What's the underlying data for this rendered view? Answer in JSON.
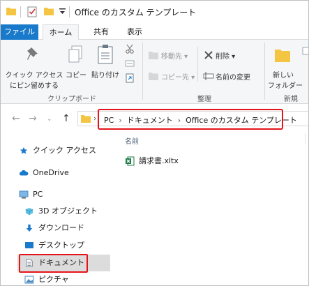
{
  "window": {
    "title": "Office のカスタム テンプレート"
  },
  "ribbon_tabs": [
    {
      "label": "ファイル"
    },
    {
      "label": "ホーム"
    },
    {
      "label": "共有"
    },
    {
      "label": "表示"
    }
  ],
  "clipboard": {
    "pin_line1": "クイック アクセス",
    "pin_line2": "にピン留めする",
    "copy": "コピー",
    "paste": "貼り付け",
    "group_name": "クリップボード"
  },
  "organize": {
    "move_to": "移動先",
    "copy_to": "コピー先",
    "delete": "削除",
    "rename": "名前の変更",
    "group_name": "整理"
  },
  "new_group": {
    "new_folder_line1": "新しい",
    "new_folder_line2": "フォルダー",
    "group_name": "新規"
  },
  "breadcrumb": [
    "PC",
    "ドキュメント",
    "Office のカスタム テンプレート"
  ],
  "nav_pane": {
    "items": [
      {
        "label": "クイック アクセス",
        "icon": "star-icon"
      },
      {
        "label": "OneDrive",
        "icon": "cloud-icon"
      },
      {
        "label": "PC",
        "icon": "computer-icon"
      },
      {
        "label": "3D オブジェクト",
        "icon": "cube-icon"
      },
      {
        "label": "ダウンロード",
        "icon": "download-icon"
      },
      {
        "label": "デスクトップ",
        "icon": "desktop-icon"
      },
      {
        "label": "ドキュメント",
        "icon": "document-icon",
        "selected": true
      },
      {
        "label": "ピクチャ",
        "icon": "picture-icon"
      }
    ]
  },
  "content": {
    "column_name": "名前",
    "files": [
      {
        "name": "請求書.xltx",
        "icon": "excel-template-icon"
      }
    ]
  },
  "colors": {
    "accent": "#1979ca",
    "highlight": "#e5141a",
    "folder": "#f4c542"
  }
}
